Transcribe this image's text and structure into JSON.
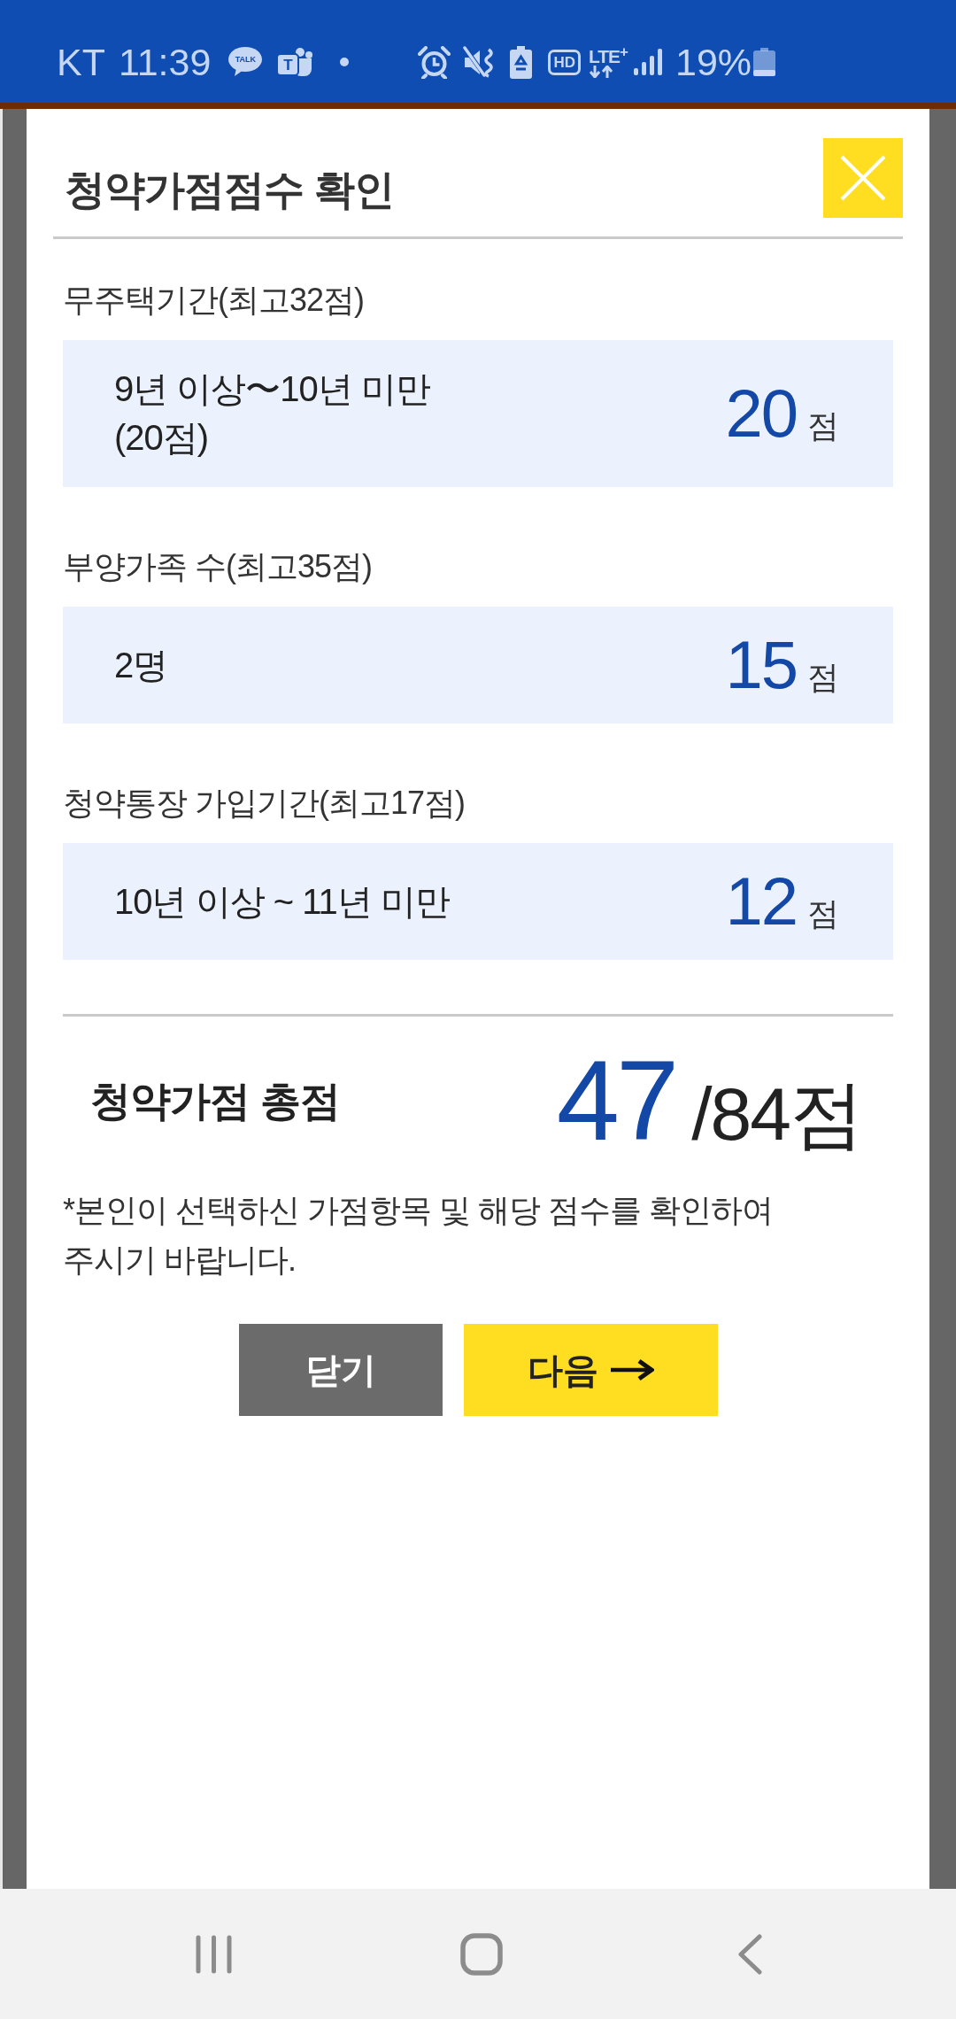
{
  "status_bar": {
    "carrier": "KT",
    "time": "11:39",
    "notifications": [
      {
        "kind": "chat",
        "text": "TALK"
      },
      {
        "kind": "app",
        "text": "T"
      },
      {
        "kind": "dot"
      }
    ],
    "indicators": [
      {
        "kind": "alarm"
      },
      {
        "kind": "mute"
      },
      {
        "kind": "battery_saver"
      },
      {
        "kind": "hd",
        "text": "HD"
      },
      {
        "kind": "network",
        "text": "LTE$^{+}$"
      },
      {
        "kind": "signal"
      }
    ],
    "battery": "19%"
  },
  "dialog": {
    "title": "청약가점점수 확인",
    "sections": [
      {
        "label": "무주택기간(최고32점)",
        "answer": "9년 이상〜10년 미만\n(20점)",
        "score": "20",
        "unit": "점"
      },
      {
        "label": "부양가족 수(최고35점)",
        "answer": "2명",
        "score": "15",
        "unit": "점"
      },
      {
        "label": "청약통장 가입기간(최고17점)",
        "answer": "10년 이상 ~ 11년 미만",
        "score": "12",
        "unit": "점"
      }
    ],
    "total": {
      "label": "청약가점 총점",
      "score": "47",
      "max": "/84점"
    },
    "note": "*본인이 선택하신 가점항목 및 해당 점수를 확인하여\n주시기 바랍니다.",
    "buttons": [
      {
        "kind": "close",
        "label": "닫기"
      },
      {
        "kind": "next",
        "label": "다음"
      }
    ]
  },
  "nav_bar": [
    {
      "kind": "recents"
    },
    {
      "kind": "home"
    },
    {
      "kind": "back"
    }
  ]
}
